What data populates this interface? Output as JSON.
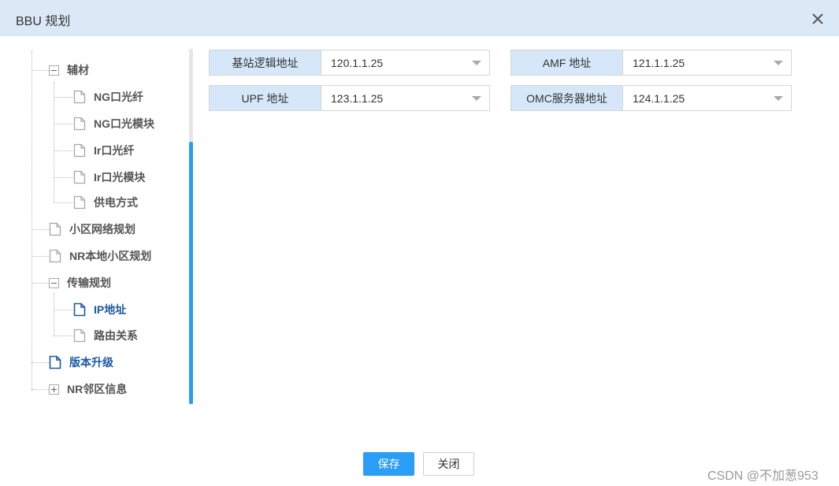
{
  "dialog": {
    "title": "BBU 规划"
  },
  "tree": {
    "items": [
      {
        "label": "辅材"
      },
      {
        "label": "NG口光纤"
      },
      {
        "label": "NG口光模块"
      },
      {
        "label": "Ir口光纤"
      },
      {
        "label": "Ir口光模块"
      },
      {
        "label": "供电方式"
      },
      {
        "label": "小区网络规划"
      },
      {
        "label": "NR本地小区规划"
      },
      {
        "label": "传输规划"
      },
      {
        "label": "IP地址"
      },
      {
        "label": "路由关系"
      },
      {
        "label": "版本升级"
      },
      {
        "label": "NR邻区信息"
      }
    ]
  },
  "form": {
    "fields": [
      {
        "label": "基站逻辑地址",
        "value": "120.1.1.25"
      },
      {
        "label": "AMF 地址",
        "value": "121.1.1.25"
      },
      {
        "label": "UPF 地址",
        "value": "123.1.1.25"
      },
      {
        "label": "OMC服务器地址",
        "value": "124.1.1.25"
      }
    ]
  },
  "footer": {
    "save_label": "保存",
    "close_label": "关闭"
  },
  "watermark": "CSDN @不加葱953",
  "colors": {
    "accent": "#2a9df4",
    "title_bar": "#dbe9f7",
    "label_bg": "#d5e7f8",
    "active_text": "#1a5aa0"
  }
}
